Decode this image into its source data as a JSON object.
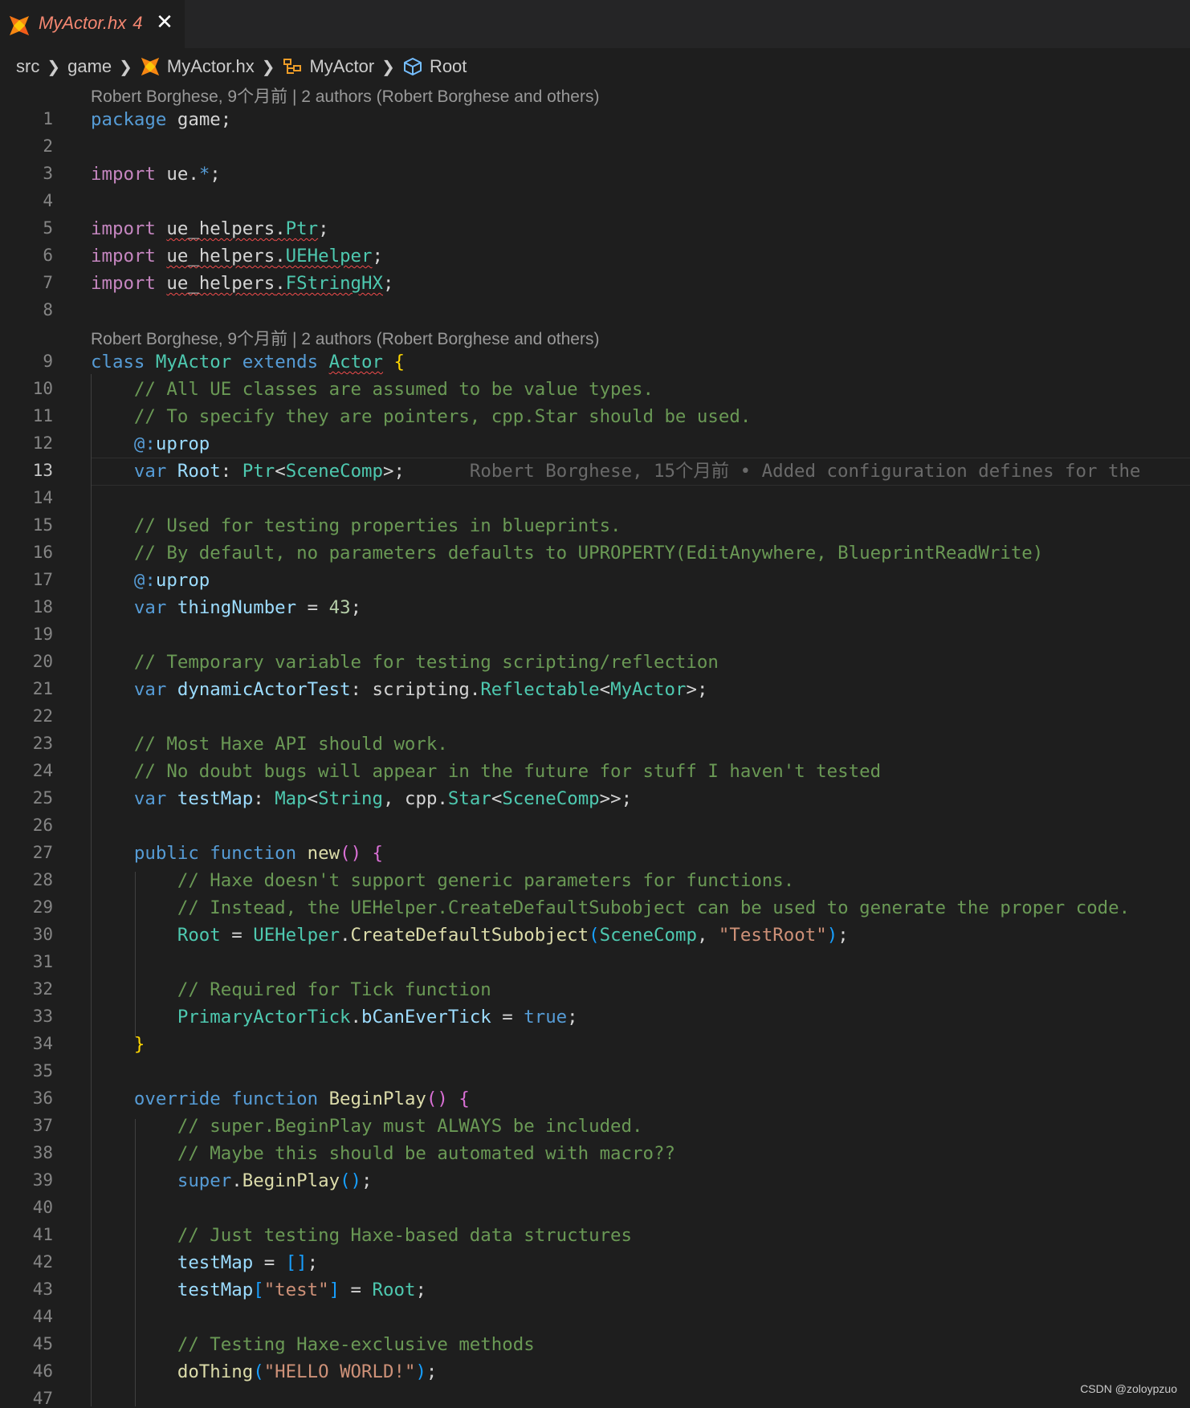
{
  "tab": {
    "filename": "MyActor.hx",
    "problem_count": "4",
    "close_glyph": "✕"
  },
  "breadcrumb": {
    "items": [
      "src",
      "game",
      "MyActor.hx",
      "MyActor",
      "Root"
    ]
  },
  "blame": {
    "header": "Robert Borghese, 9个月前 | 2 authors (Robert Borghese and others)",
    "class_header": "Robert Borghese, 9个月前 | 2 authors (Robert Borghese and others)",
    "inline_line13": "Robert Borghese, 15个月前 • Added configuration defines for the"
  },
  "editor": {
    "active_line": 13,
    "line_numbers": [
      "1",
      "2",
      "3",
      "4",
      "5",
      "6",
      "7",
      "8",
      "9",
      "10",
      "11",
      "12",
      "13",
      "14",
      "15",
      "16",
      "17",
      "18",
      "19",
      "20",
      "21",
      "22",
      "23",
      "24",
      "25",
      "26",
      "27",
      "28",
      "29",
      "30",
      "31",
      "32",
      "33",
      "34",
      "35",
      "36",
      "37",
      "38",
      "39",
      "40",
      "41",
      "42",
      "43",
      "44",
      "45",
      "46",
      "47"
    ],
    "lines": [
      "package game;",
      "",
      "import ue.*;",
      "",
      "import ue_helpers.Ptr;",
      "import ue_helpers.UEHelper;",
      "import ue_helpers.FStringHX;",
      "",
      "class MyActor extends Actor {",
      "    // All UE classes are assumed to be value types.",
      "    // To specify they are pointers, cpp.Star should be used.",
      "    @:uprop",
      "    var Root: Ptr<SceneComp>;",
      "",
      "    // Used for testing properties in blueprints.",
      "    // By default, no parameters defaults to UPROPERTY(EditAnywhere, BlueprintReadWrite)",
      "    @:uprop",
      "    var thingNumber = 43;",
      "",
      "    // Temporary variable for testing scripting/reflection",
      "    var dynamicActorTest: scripting.Reflectable<MyActor>;",
      "",
      "    // Most Haxe API should work.",
      "    // No doubt bugs will appear in the future for stuff I haven't tested",
      "    var testMap: Map<String, cpp.Star<SceneComp>>;",
      "",
      "    public function new() {",
      "        // Haxe doesn't support generic parameters for functions.",
      "        // Instead, the UEHelper.CreateDefaultSubobject can be used to generate the proper code.",
      "        Root = UEHelper.CreateDefaultSubobject(SceneComp, \"TestRoot\");",
      "",
      "        // Required for Tick function",
      "        PrimaryActorTick.bCanEverTick = true;",
      "    }",
      "",
      "    override function BeginPlay() {",
      "        // super.BeginPlay must ALWAYS be included.",
      "        // Maybe this should be automated with macro??",
      "        super.BeginPlay();",
      "",
      "        // Just testing Haxe-based data structures",
      "        testMap = [];",
      "        testMap[\"test\"] = Root;",
      "",
      "        // Testing Haxe-exclusive methods",
      "        doThing(\"HELLO WORLD!\");",
      ""
    ]
  },
  "watermark": "CSDN @zoloypzuo",
  "colors": {
    "keyword": "#569cd6",
    "control": "#c586c0",
    "type": "#4ec9b0",
    "comment": "#6a9955",
    "string": "#ce9178",
    "function": "#dcdcaa",
    "variable": "#9cdcfe",
    "error": "#f14c4c",
    "haxe_icon": "#f68712"
  }
}
